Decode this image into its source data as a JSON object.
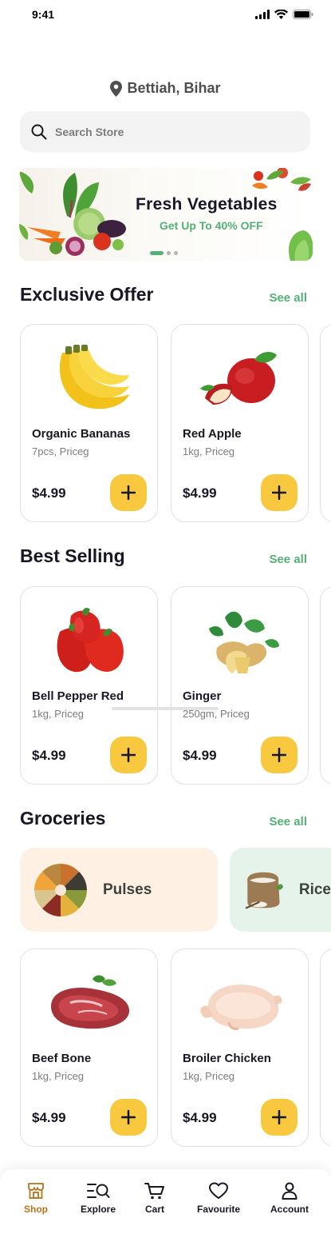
{
  "status_bar": {
    "time": "9:41"
  },
  "location": {
    "text": "Bettiah, Bihar"
  },
  "search": {
    "placeholder": "Search Store"
  },
  "banner": {
    "title": "Fresh Vegetables",
    "subtitle": "Get Up To 40% OFF"
  },
  "sections": {
    "exclusive": {
      "title": "Exclusive Offer",
      "see_all": "See all",
      "products": [
        {
          "name": "Organic Bananas",
          "detail": "7pcs, Priceg",
          "price": "$4.99"
        },
        {
          "name": "Red Apple",
          "detail": "1kg, Priceg",
          "price": "$4.99"
        }
      ]
    },
    "best": {
      "title": "Best Selling",
      "see_all": "See all",
      "products": [
        {
          "name": "Bell Pepper Red",
          "detail": "1kg, Priceg",
          "price": "$4.99"
        },
        {
          "name": "Ginger",
          "detail": "250gm, Priceg",
          "price": "$4.99"
        }
      ]
    },
    "groceries": {
      "title": "Groceries",
      "see_all": "See all",
      "categories": [
        {
          "label": "Pulses",
          "color": "#FEF1E4"
        },
        {
          "label": "Rice",
          "color": "#E5F3EA"
        }
      ],
      "products": [
        {
          "name": "Beef Bone",
          "detail": "1kg, Priceg",
          "price": "$4.99"
        },
        {
          "name": "Broiler Chicken",
          "detail": "1kg, Priceg",
          "price": "$4.99"
        }
      ]
    }
  },
  "nav": [
    {
      "label": "Shop",
      "icon": "shop-icon",
      "active": true
    },
    {
      "label": "Explore",
      "icon": "explore-icon"
    },
    {
      "label": "Cart",
      "icon": "cart-icon"
    },
    {
      "label": "Favourite",
      "icon": "heart-icon"
    },
    {
      "label": "Account",
      "icon": "account-icon"
    }
  ],
  "colors": {
    "accent_green": "#53B175",
    "add_button": "#F8C93E",
    "active_nav": "#B6731C"
  }
}
